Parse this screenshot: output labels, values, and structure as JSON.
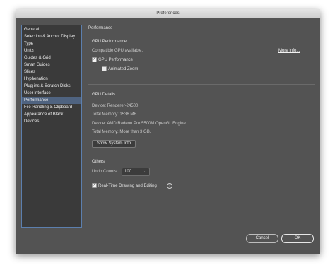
{
  "window": {
    "title": "Preferences"
  },
  "sidebar": {
    "items": [
      {
        "label": "General"
      },
      {
        "label": "Selection & Anchor Display"
      },
      {
        "label": "Type"
      },
      {
        "label": "Units"
      },
      {
        "label": "Guides & Grid"
      },
      {
        "label": "Smart Guides"
      },
      {
        "label": "Slices"
      },
      {
        "label": "Hyphenation"
      },
      {
        "label": "Plug-ins & Scratch Disks"
      },
      {
        "label": "User Interface"
      },
      {
        "label": "Performance",
        "selected": true
      },
      {
        "label": "File Handling & Clipboard"
      },
      {
        "label": "Appearance of Black"
      },
      {
        "label": "Devices"
      }
    ]
  },
  "panel": {
    "title": "Performance",
    "gpu_section": {
      "heading": "GPU Performance",
      "status": "Compatible GPU available.",
      "more_info": "More Info...",
      "gpu_performance_label": "GPU Performance",
      "gpu_performance_checked": true,
      "animated_zoom_label": "Animated Zoom",
      "animated_zoom_checked": false
    },
    "gpu_details": {
      "heading": "GPU Details",
      "device1": "Device: Renderer-24500",
      "memory1": "Total Memory: 1536 MB",
      "device2": "Device: AMD Radeon Pro 5500M OpenGL Engine",
      "memory2": "Total Memory:  More than 3 GB.",
      "show_system_info": "Show System Info"
    },
    "others": {
      "heading": "Others",
      "undo_counts_label": "Undo Counts:",
      "undo_counts_value": "100",
      "realtime_label": "Real-Time Drawing and Editing",
      "realtime_checked": true
    }
  },
  "footer": {
    "cancel": "Cancel",
    "ok": "OK"
  }
}
